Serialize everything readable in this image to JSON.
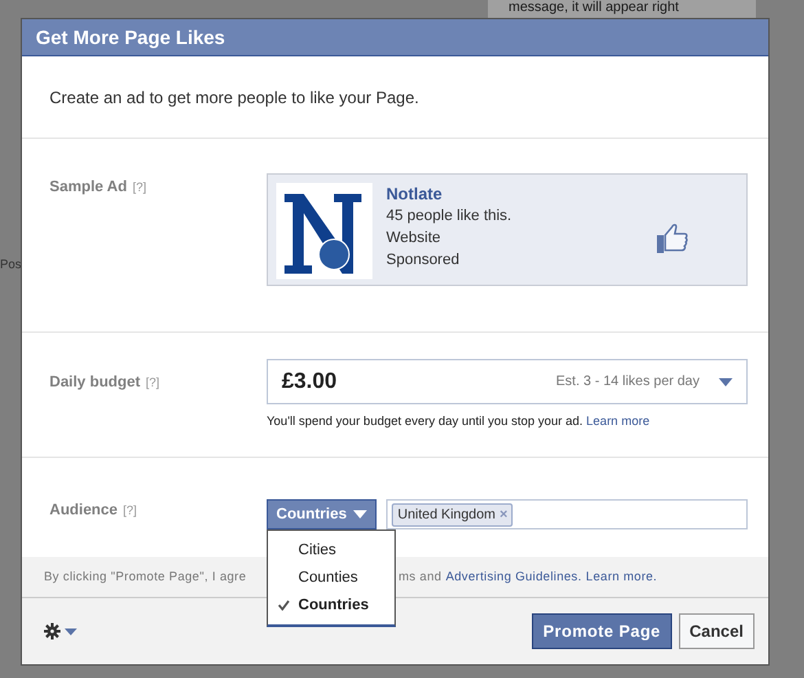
{
  "background": {
    "snippet_top": "message, it will appear right",
    "snippet_left": "Pos"
  },
  "dialog": {
    "title": "Get More Page Likes",
    "intro": "Create an ad to get more people to like your Page."
  },
  "sample_ad": {
    "label": "Sample Ad",
    "help": "[?]",
    "page_name": "Notlate",
    "likes": "45 people like this.",
    "category": "Website",
    "sponsored": "Sponsored"
  },
  "budget": {
    "label": "Daily budget",
    "help": "[?]",
    "amount": "£3.00",
    "estimate": "Est. 3 - 14 likes per day",
    "note": "You'll spend your budget every day until you stop your ad.",
    "note_link": "Learn more"
  },
  "audience": {
    "label": "Audience",
    "help": "[?]",
    "type_button": "Countries",
    "tags": [
      {
        "text": "United Kingdom",
        "remove": "×"
      }
    ],
    "menu": [
      {
        "label": "Cities",
        "selected": false
      },
      {
        "label": "Counties",
        "selected": false
      },
      {
        "label": "Countries",
        "selected": true
      }
    ]
  },
  "legal": {
    "start": "By clicking \"Promote Page\", I agre",
    "end": "ms and",
    "link_guidelines": "Advertising Guidelines.",
    "link_learn": "Learn more."
  },
  "footer": {
    "buttons": [
      {
        "label": "Promote Page",
        "kind": "primary"
      },
      {
        "label": "Cancel",
        "kind": "secondary"
      }
    ]
  }
}
